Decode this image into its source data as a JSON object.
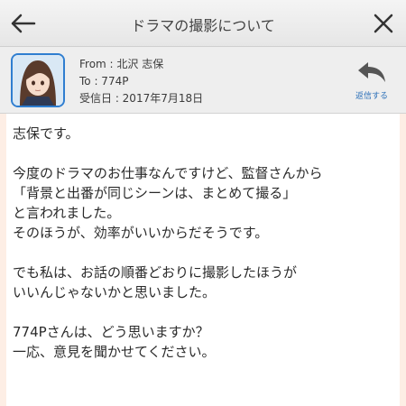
{
  "header_bar": {
    "title": "ドラマの撮影について"
  },
  "mail": {
    "from": "From : 北沢 志保",
    "to": "To : 774P",
    "received": "受信日 : 2017年7月18日",
    "reply_label": "返信する"
  },
  "message": {
    "lines": [
      "志保です。",
      "今度のドラマのお仕事なんですけど、監督さんから",
      "「背景と出番が同じシーンは、まとめて撮る」",
      "と言われました。",
      "そのほうが、効率がいいからだそうです。",
      "でも私は、お話の順番どおりに撮影したほうが",
      "いいんじゃないかと思いました。",
      "774Pさんは、どう思いますか？",
      "一応、意見を聞かせてください。"
    ]
  },
  "colors": {
    "accent_blue": "#2f7ed0",
    "header_gray": "#eeeeee",
    "side_peach": "#fdeee5"
  },
  "icons": {
    "back": "back-arrow-icon",
    "close": "close-icon",
    "reply": "reply-arrow-icon"
  }
}
